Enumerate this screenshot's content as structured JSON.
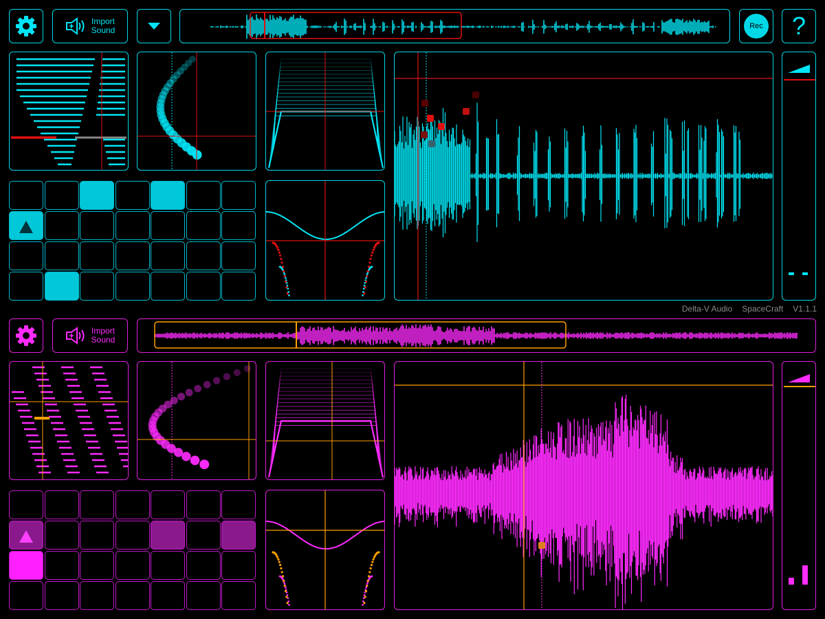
{
  "colors": {
    "cyan": "#00e5f5",
    "magenta": "#ff2bff",
    "red": "#e01010",
    "orange": "#ffa000"
  },
  "top": {
    "settings_icon": "gear-icon",
    "import": {
      "line1": "Import",
      "line2": "Sound",
      "icon": "speaker-plus-icon"
    },
    "dropdown_icon": "triangle-down-icon",
    "rec_label": "Rec",
    "help_label": "?",
    "pads_active": [
      2,
      4,
      22
    ],
    "play_pad": 7
  },
  "bottom": {
    "settings_icon": "gear-icon",
    "import": {
      "line1": "Import",
      "line2": "Sound",
      "icon": "speaker-plus-icon"
    },
    "pads_active": [
      11,
      13
    ],
    "pads_bright": [
      14
    ],
    "play_pad": 7
  },
  "credits": {
    "company": "Delta-V Audio",
    "product": "SpaceCraft",
    "version": "V1.1.1"
  }
}
